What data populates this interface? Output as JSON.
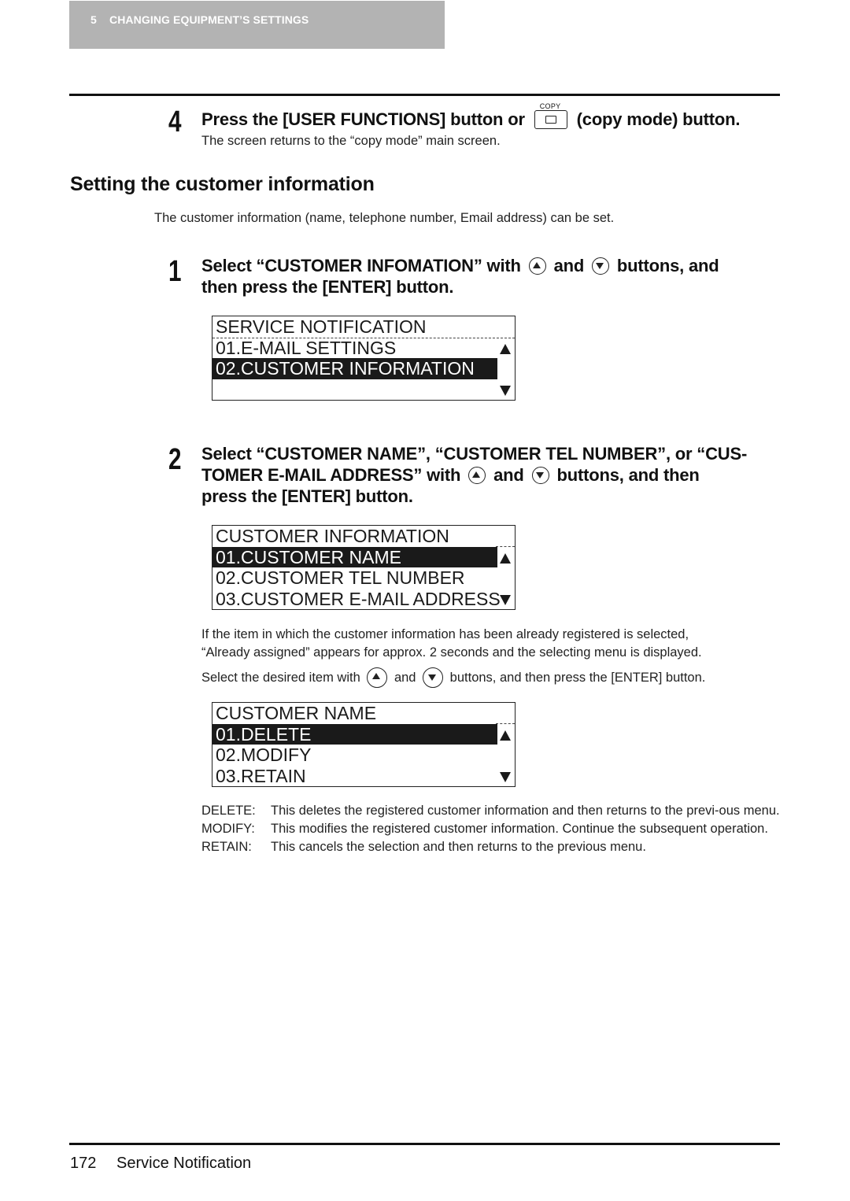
{
  "header": {
    "chapter_number": "5",
    "chapter_title": "CHANGING EQUIPMENT’S SETTINGS"
  },
  "step4": {
    "number": "4",
    "text_before": "Press the [USER FUNCTIONS] button or",
    "copy_button_label": "COPY",
    "text_after": "(copy mode) button.",
    "note": "The screen returns to the “copy mode” main screen."
  },
  "section": {
    "title": "Setting the customer information",
    "intro": "The customer information (name, telephone number, Email address) can be set."
  },
  "step1": {
    "number": "1",
    "line1_a": "Select “CUSTOMER INFOMATION” with",
    "and": "and",
    "line1_b": "buttons, and",
    "line2": "then press the [ENTER] button."
  },
  "lcd1": {
    "rows": [
      {
        "text": "SERVICE NOTIFICATION",
        "selected": false
      },
      {
        "text": "01.E-MAIL SETTINGS",
        "selected": false
      },
      {
        "text": "02.CUSTOMER INFORMATION",
        "selected": true
      },
      {
        "text": "",
        "selected": false
      }
    ]
  },
  "step2": {
    "number": "2",
    "line1": "Select “CUSTOMER NAME”, “CUSTOMER TEL NUMBER”, or “CUS-",
    "line2_a": "TOMER E-MAIL ADDRESS” with",
    "and": "and",
    "line2_b": "buttons, and then",
    "line3": "press the [ENTER] button."
  },
  "lcd2": {
    "rows": [
      {
        "text": "CUSTOMER INFORMATION",
        "selected": false
      },
      {
        "text": "01.CUSTOMER NAME",
        "selected": true
      },
      {
        "text": "02.CUSTOMER TEL NUMBER",
        "selected": false
      },
      {
        "text": "03.CUSTOMER E-MAIL ADDRESS",
        "selected": false
      }
    ]
  },
  "note2": {
    "line1": "If the item in which the customer information has been already registered is selected,",
    "line2": "“Already assigned” appears for approx. 2 seconds and the selecting menu is displayed.",
    "line3_a": "Select the desired item with",
    "and": "and",
    "line3_b": "buttons, and then press the [ENTER] button."
  },
  "lcd3": {
    "rows": [
      {
        "text": "CUSTOMER NAME",
        "selected": false
      },
      {
        "text": "01.DELETE",
        "selected": true
      },
      {
        "text": "02.MODIFY",
        "selected": false
      },
      {
        "text": "03.RETAIN",
        "selected": false
      }
    ]
  },
  "descriptions": [
    {
      "key": "DELETE:",
      "value": "This deletes the registered customer information and then returns to the previ-ous menu."
    },
    {
      "key": "MODIFY:",
      "value": "This modifies the registered customer information. Continue the subsequent operation."
    },
    {
      "key": "RETAIN:",
      "value": "This cancels the selection and then returns to the previous menu."
    }
  ],
  "footer": {
    "page_number": "172",
    "title": "Service Notification"
  }
}
